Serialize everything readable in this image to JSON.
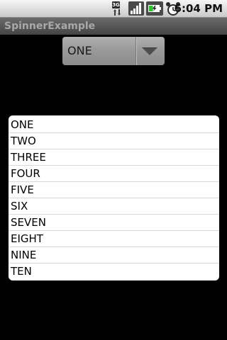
{
  "status_bar": {
    "network_label": "3G",
    "time": "6:04 PM",
    "icons": [
      "3g-data-icon",
      "signal-strength-icon",
      "battery-charging-icon",
      "alarm-clock-icon"
    ],
    "battery_level_percent": 40
  },
  "app": {
    "title": "SpinnerExample"
  },
  "spinner": {
    "selected_value": "ONE",
    "arrow_icon": "dropdown-arrow-icon"
  },
  "dropdown": {
    "items": [
      "ONE",
      "TWO",
      "THREE",
      "FOUR",
      "FIVE",
      "SIX",
      "SEVEN",
      "EIGHT",
      "NINE",
      "TEN"
    ]
  },
  "colors": {
    "background": "#000000",
    "list_background": "#ffffff",
    "battery_green": "#2fc42f",
    "spinner_gray": "#9a9a9a"
  }
}
